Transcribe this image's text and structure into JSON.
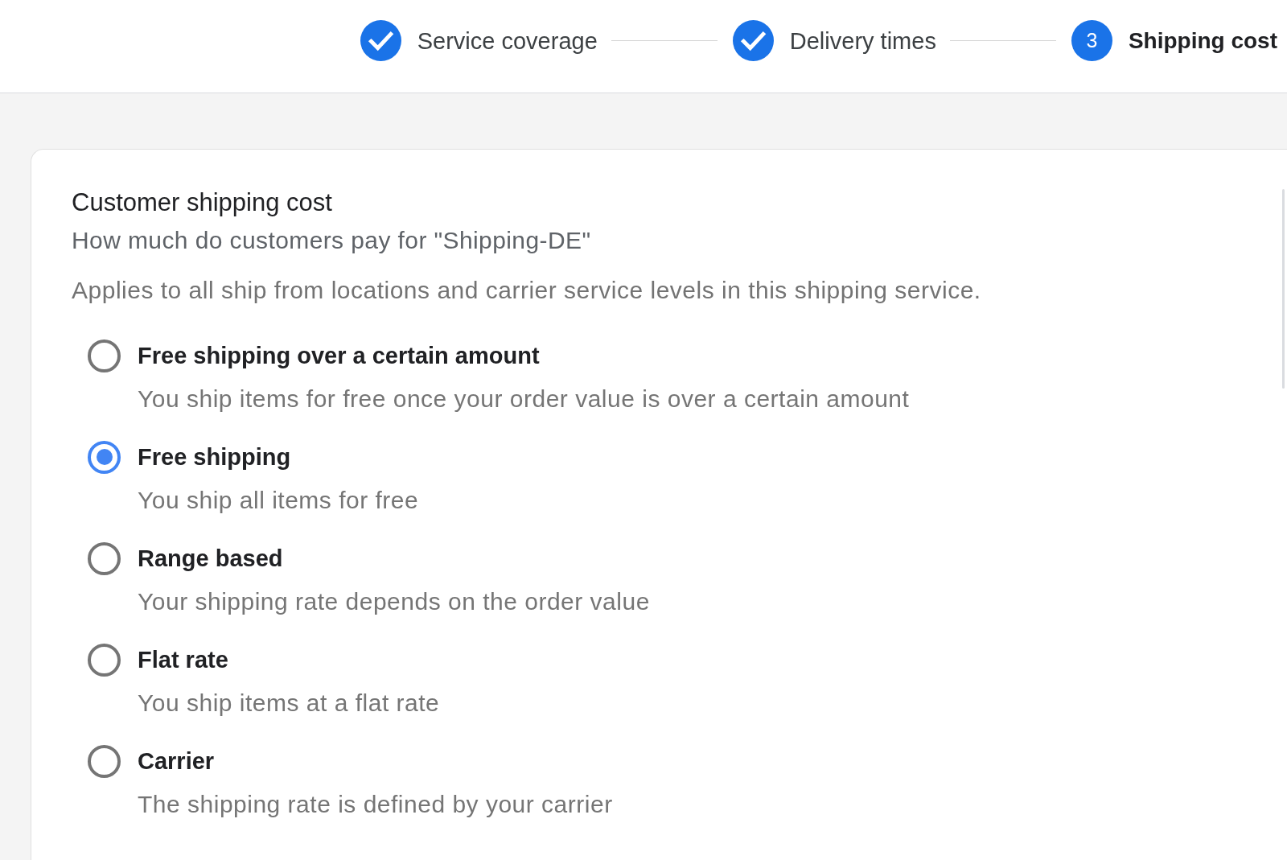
{
  "stepper": {
    "steps": [
      {
        "label": "Service coverage",
        "kind": "complete"
      },
      {
        "label": "Delivery times",
        "kind": "complete"
      },
      {
        "label": "Shipping cost",
        "kind": "current",
        "number": "3"
      }
    ]
  },
  "card": {
    "title": "Customer shipping cost",
    "subtitle": "How much do customers pay for \"Shipping-DE\"",
    "note": "Applies to all ship from locations and carrier service levels in this shipping service.",
    "options": [
      {
        "label": "Free shipping over a certain amount",
        "description": "You ship items for free once your order value is over a certain amount",
        "selected": false
      },
      {
        "label": "Free shipping",
        "description": "You ship all items for free",
        "selected": true
      },
      {
        "label": "Range based",
        "description": "Your shipping rate depends on the order value",
        "selected": false
      },
      {
        "label": "Flat rate",
        "description": "You ship items at a flat rate",
        "selected": false
      },
      {
        "label": "Carrier",
        "description": "The shipping rate is defined by your carrier",
        "selected": false
      }
    ]
  }
}
